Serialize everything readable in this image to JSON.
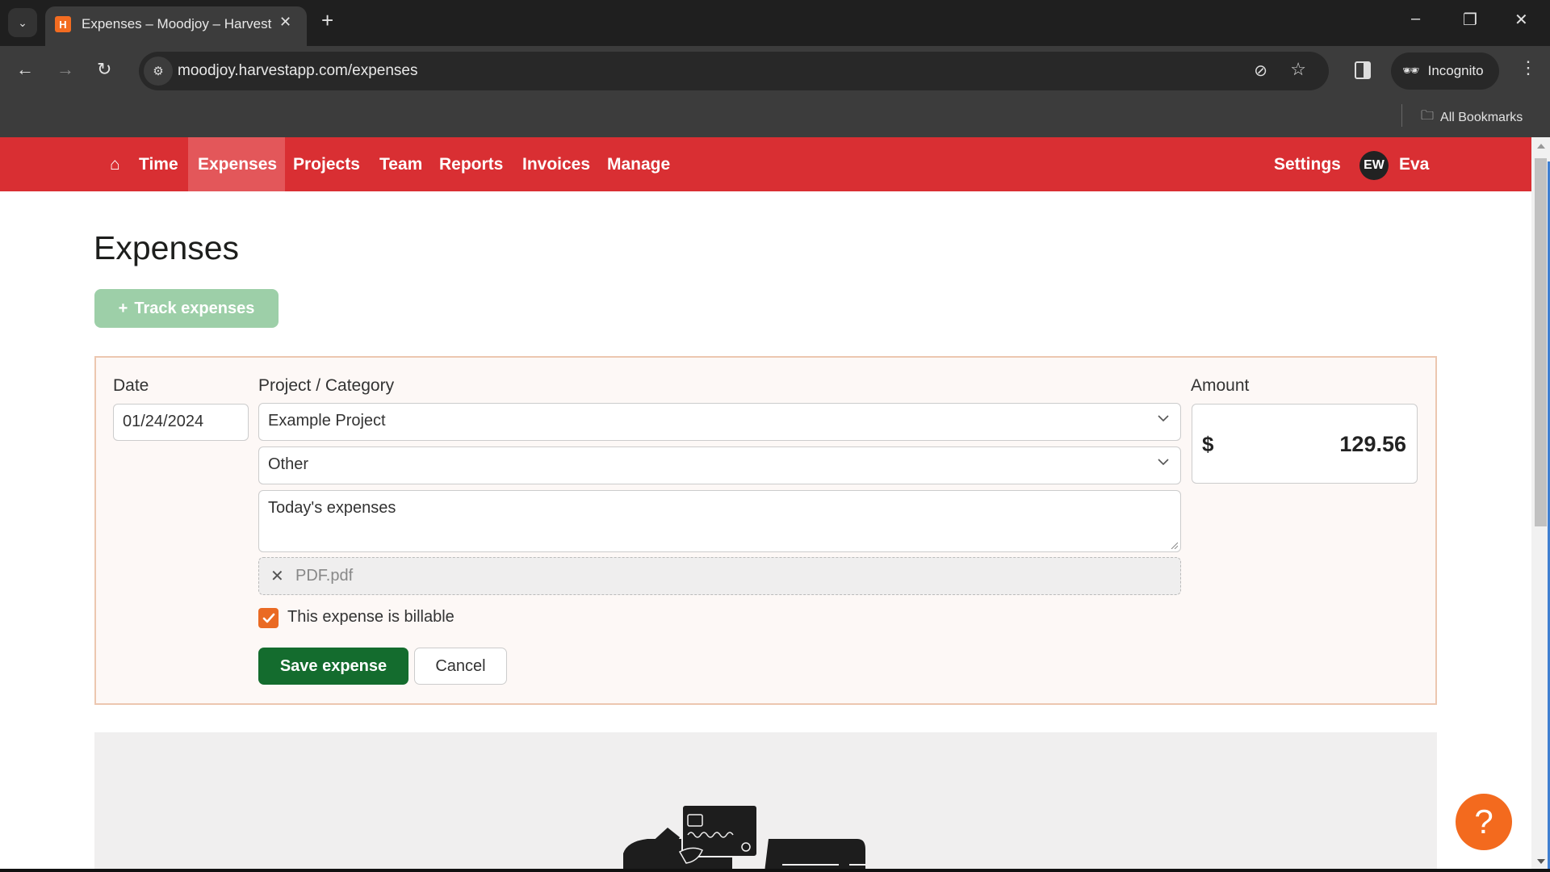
{
  "browser": {
    "tab_title": "Expenses – Moodjoy – Harvest",
    "favicon_letter": "H",
    "url": "moodjoy.harvestapp.com/expenses",
    "profile_label": "Incognito",
    "bookmarks_label": "All Bookmarks",
    "icons": {
      "back": "←",
      "forward": "→",
      "reload": "↻",
      "minimize": "–",
      "restore": "❐",
      "close": "✕",
      "new_tab": "+",
      "tab_close": "✕",
      "tab_list": "⌄",
      "site_info": "⚙",
      "eye_off": "⊘",
      "star": "☆",
      "menu": "⋮",
      "incognito": "🕶",
      "folder": "🗀"
    }
  },
  "nav": {
    "home_icon": "⌂",
    "items": [
      {
        "label": "Time",
        "active": false
      },
      {
        "label": "Expenses",
        "active": true
      },
      {
        "label": "Projects",
        "active": false
      },
      {
        "label": "Team",
        "active": false
      },
      {
        "label": "Reports",
        "active": false
      },
      {
        "label": "Invoices",
        "active": false
      },
      {
        "label": "Manage",
        "active": false
      }
    ],
    "settings_label": "Settings",
    "user_initials": "EW",
    "user_name": "Eva",
    "brand_color": "#d92f33"
  },
  "page": {
    "title": "Expenses",
    "track_button": {
      "icon": "+",
      "label": "Track expenses"
    }
  },
  "form": {
    "date_label": "Date",
    "date_value": "01/24/2024",
    "project_label": "Project / Category",
    "project_value": "Example Project",
    "category_value": "Other",
    "notes_value": "Today's expenses",
    "attachment": {
      "remove_icon": "✕",
      "filename": "PDF.pdf"
    },
    "billable_label": "This expense is billable",
    "billable_checked": true,
    "amount_label": "Amount",
    "currency_symbol": "$",
    "amount_value": "129.56",
    "save_label": "Save expense",
    "cancel_label": "Cancel"
  },
  "help": {
    "icon": "?"
  }
}
